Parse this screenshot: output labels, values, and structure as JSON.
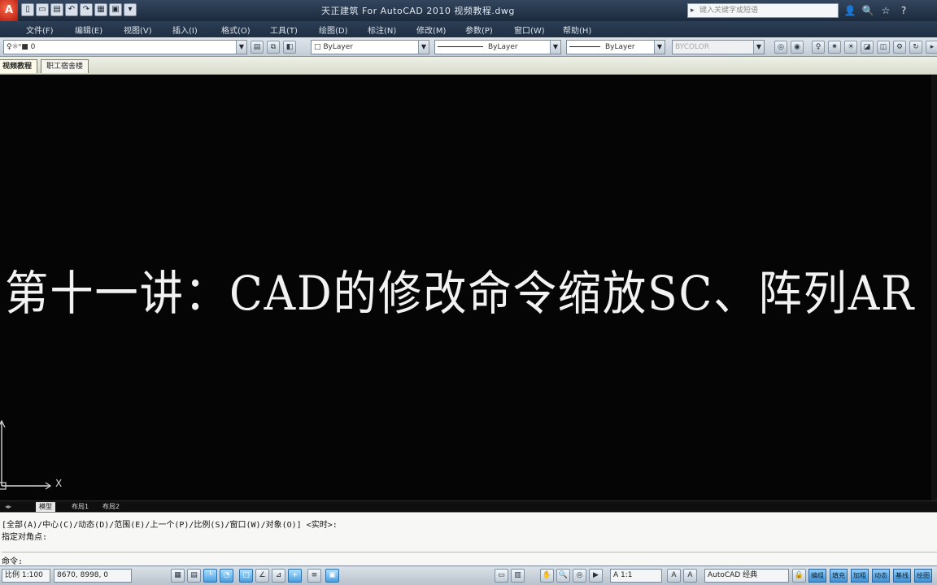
{
  "window": {
    "app_logo": "A",
    "title": "天正建筑 For AutoCAD 2010  视频教程.dwg",
    "search_placeholder": "键入关键字或短语"
  },
  "quick_access": [
    "▯",
    "▭",
    "▤",
    "↶",
    "↷",
    "▦",
    "▣",
    "▾"
  ],
  "title_icons": [
    "user-icon",
    "search-icon",
    "star-icon",
    "help-icon"
  ],
  "menu": [
    "文件(F)",
    "编辑(E)",
    "视图(V)",
    "插入(I)",
    "格式(O)",
    "工具(T)",
    "绘图(D)",
    "标注(N)",
    "修改(M)",
    "参数(P)",
    "窗口(W)",
    "帮助(H)"
  ],
  "toolbar": {
    "layer_value": "♀☼ⁿ■ 0",
    "color_value": "ByLayer",
    "linetype_value": "ByLayer",
    "lineweight_value": "ByLayer",
    "plotstyle_value": "BYCOLOR"
  },
  "doc_tabs": [
    "视频教程",
    "职工宿舍楼"
  ],
  "drawing": {
    "lecture_title": "第十一讲：CAD的修改命令缩放SC、阵列AR",
    "ucs_label": "X"
  },
  "layout_tabs": [
    "模型",
    "布局1",
    "布局2"
  ],
  "command": {
    "line1": "[全部(A)/中心(C)/动态(D)/范围(E)/上一个(P)/比例(S)/窗口(W)/对象(O)] <实时>:",
    "line2": "指定对角点:",
    "prompt": "命令:"
  },
  "status": {
    "scale": "比例 1:100",
    "coords": "8670, 8998, 0",
    "annotation_scale": "A 1:1",
    "workspace": "AutoCAD 经典",
    "toggles": [
      "编组",
      "填充",
      "加粗",
      "动态",
      "基线",
      "绘图"
    ]
  },
  "colors": {
    "canvas": "#050505",
    "title_text": "#f2f2f2",
    "status_on": "#4a9fe0"
  }
}
